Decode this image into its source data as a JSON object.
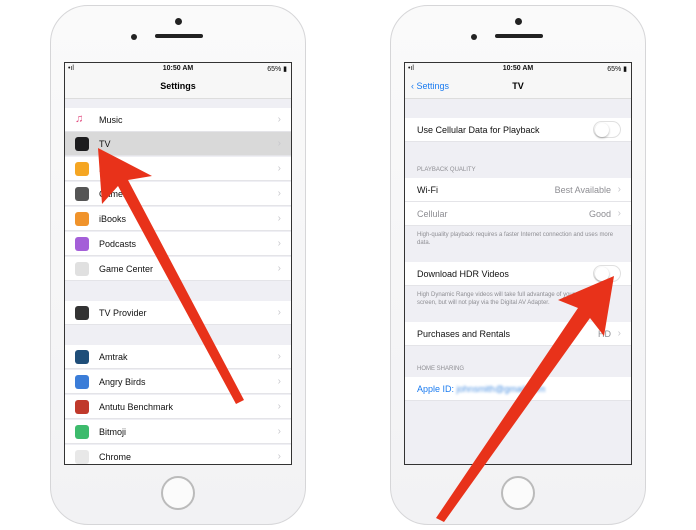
{
  "status": {
    "time": "10:50 AM",
    "battery": "65%",
    "signal": "•ıl"
  },
  "left": {
    "title": "Settings",
    "items": [
      {
        "label": "Music",
        "icon": "music-icon",
        "color": "#fff"
      },
      {
        "label": "TV",
        "icon": "tv-icon",
        "color": "#1c1c1e",
        "selected": true
      },
      {
        "label": "Photos",
        "icon": "photos-icon",
        "color": "#f5a623"
      },
      {
        "label": "Camera",
        "icon": "camera-icon",
        "color": "#555"
      },
      {
        "label": "iBooks",
        "icon": "ibooks-icon",
        "color": "#f0932b"
      },
      {
        "label": "Podcasts",
        "icon": "podcasts-icon",
        "color": "#a45fd8"
      },
      {
        "label": "Game Center",
        "icon": "game-center-icon",
        "color": "#e0e0e0"
      },
      {
        "label": "TV Provider",
        "icon": "tv-provider-icon",
        "color": "#333"
      },
      {
        "label": "Amtrak",
        "icon": "amtrak-icon",
        "color": "#1f4e79"
      },
      {
        "label": "Angry Birds",
        "icon": "angry-birds-icon",
        "color": "#3b7dd8"
      },
      {
        "label": "Antutu Benchmark",
        "icon": "antutu-icon",
        "color": "#c0392b"
      },
      {
        "label": "Bitmoji",
        "icon": "bitmoji-icon",
        "color": "#3dbb6c"
      },
      {
        "label": "Chrome",
        "icon": "chrome-icon",
        "color": "#e8e8e8"
      }
    ]
  },
  "right": {
    "back": "Settings",
    "title": "TV",
    "cellular_toggle": {
      "label": "Use Cellular Data for Playback",
      "on": false
    },
    "playback_header": "PLAYBACK QUALITY",
    "wifi": {
      "label": "Wi-Fi",
      "value": "Best Available"
    },
    "cellular": {
      "label": "Cellular",
      "value": "Good"
    },
    "playback_footer": "High-quality playback requires a faster Internet connection and uses more data.",
    "hdr_toggle": {
      "label": "Download HDR Videos",
      "on": false
    },
    "hdr_footer": "High Dynamic Range videos will take full advantage of your device's screen, but will not play via the Digital AV Adapter.",
    "purchases": {
      "label": "Purchases and Rentals",
      "value": "HD"
    },
    "home_header": "HOME SHARING",
    "apple_id": {
      "label": "Apple ID:",
      "value": "johnsmith@gmail.com"
    }
  },
  "colors": {
    "arrow": "#e8321a",
    "link": "#1a7bf0"
  }
}
